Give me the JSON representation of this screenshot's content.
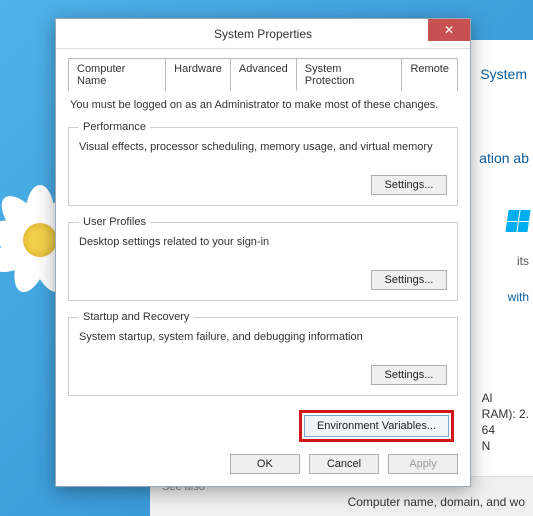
{
  "dialog": {
    "title": "System Properties",
    "close_glyph": "✕",
    "tabs": [
      "Computer Name",
      "Hardware",
      "Advanced",
      "System Protection",
      "Remote"
    ],
    "active_tab_index": 2,
    "admin_notice": "You must be logged on as an Administrator to make most of these changes.",
    "sections": {
      "performance": {
        "legend": "Performance",
        "desc": "Visual effects, processor scheduling, memory usage, and virtual memory",
        "settings_label": "Settings..."
      },
      "user_profiles": {
        "legend": "User Profiles",
        "desc": "Desktop settings related to your sign-in",
        "settings_label": "Settings..."
      },
      "startup_recovery": {
        "legend": "Startup and Recovery",
        "desc": "System startup, system failure, and debugging information",
        "settings_label": "Settings..."
      }
    },
    "env_button": "Environment Variables...",
    "buttons": {
      "ok": "OK",
      "cancel": "Cancel",
      "apply": "Apply"
    }
  },
  "background": {
    "system_label": "System",
    "ation_fragment": "ation ab",
    "its_fragment": "its",
    "with_fragment": "with",
    "spec_lines": [
      "Al",
      "RAM):    2.",
      "64",
      "N"
    ],
    "see_also": "See also",
    "bottom_text": "Computer name, domain, and wo"
  }
}
